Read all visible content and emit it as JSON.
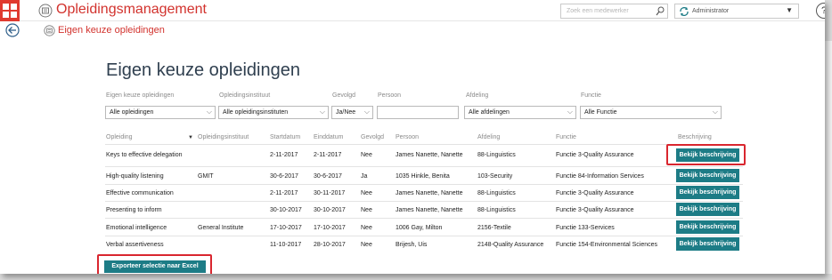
{
  "app": {
    "title": "Opleidingsmanagement",
    "search_placeholder": "Zoek een medewerker",
    "role": "Administrator",
    "help_label": "?"
  },
  "subbar": {
    "title": "Eigen keuze opleidingen"
  },
  "page": {
    "title": "Eigen keuze opleidingen"
  },
  "filters": {
    "opleidingen": {
      "label": "Eigen keuze opleidingen",
      "value": "Alle opleidingen"
    },
    "instituut": {
      "label": "Opleidingsinstituut",
      "value": "Alle opleidingsinstituten"
    },
    "gevolgd": {
      "label": "Gevolgd",
      "value": "Ja/Nee"
    },
    "persoon": {
      "label": "Persoon",
      "value": ""
    },
    "afdeling": {
      "label": "Afdeling",
      "value": "Alle afdelingen"
    },
    "functie": {
      "label": "Functie",
      "value": "Alle Functie"
    }
  },
  "table": {
    "headers": {
      "opleiding": "Opleiding",
      "instituut": "Opleidingsinstituut",
      "startdatum": "Startdatum",
      "einddatum": "Einddatum",
      "gevolgd": "Gevolgd",
      "persoon": "Persoon",
      "afdeling": "Afdeling",
      "functie": "Functie",
      "beschrijving": "Beschrijving"
    },
    "button_label": "Bekijk beschrijving",
    "rows": [
      {
        "opleiding": "Keys to effective delegation",
        "instituut": "",
        "start": "2-11-2017",
        "eind": "2-11-2017",
        "gevolgd": "Nee",
        "persoon": "James Nanette, Nanette",
        "afdeling": "88-Linguistics",
        "functie": "Functie 3-Quality Assurance"
      },
      {
        "opleiding": "High-quality listening",
        "instituut": "GMIT",
        "start": "30-6-2017",
        "eind": "30-6-2017",
        "gevolgd": "Ja",
        "persoon": "1035 Hinkle, Benita",
        "afdeling": "103-Security",
        "functie": "Functie 84-Information Services"
      },
      {
        "opleiding": "Effective communication",
        "instituut": "",
        "start": "2-11-2017",
        "eind": "30-11-2017",
        "gevolgd": "Nee",
        "persoon": "James Nanette, Nanette",
        "afdeling": "88-Linguistics",
        "functie": "Functie 3-Quality Assurance"
      },
      {
        "opleiding": "Presenting to inform",
        "instituut": "",
        "start": "30-10-2017",
        "eind": "30-10-2017",
        "gevolgd": "Nee",
        "persoon": "James Nanette, Nanette",
        "afdeling": "88-Linguistics",
        "functie": "Functie 3-Quality Assurance"
      },
      {
        "opleiding": "Emotional intelligence",
        "instituut": "General Institute",
        "start": "17-10-2017",
        "eind": "17-10-2017",
        "gevolgd": "Nee",
        "persoon": "1006 Gay, Milton",
        "afdeling": "2156-Textile",
        "functie": "Functie 133-Services"
      },
      {
        "opleiding": "Verbal assertiveness",
        "instituut": "",
        "start": "11-10-2017",
        "eind": "28-10-2017",
        "gevolgd": "Nee",
        "persoon": "Brijesh, Uis",
        "afdeling": "2148-Quality Assurance",
        "functie": "Functie 154-Environmental Sciences"
      }
    ]
  },
  "export": {
    "label": "Exporteer selectie naar Excel"
  },
  "colors": {
    "accent_red": "#d2322d",
    "button_teal": "#1d7c86",
    "highlight": "#d9262f"
  }
}
